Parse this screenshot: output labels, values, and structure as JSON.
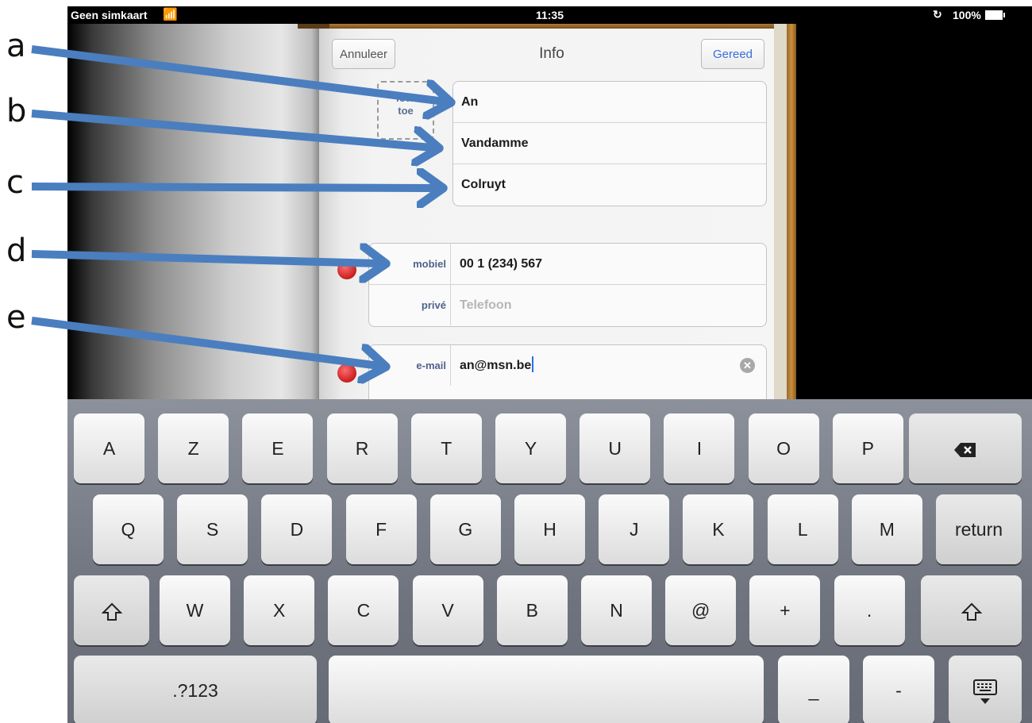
{
  "status_bar": {
    "carrier": "Geen simkaart",
    "time": "11:35",
    "battery": "100%"
  },
  "nav": {
    "cancel": "Annuleer",
    "title": "Info",
    "done": "Gereed"
  },
  "photo": {
    "line1": "foto",
    "line2": "toe"
  },
  "name_fields": {
    "first_name": "An",
    "last_name": "Vandamme",
    "company": "Colruyt"
  },
  "phone_fields": [
    {
      "label": "mobiel",
      "value": "00 1 (234) 567",
      "placeholder": ""
    },
    {
      "label": "privé",
      "value": "",
      "placeholder": "Telefoon"
    }
  ],
  "email_field": {
    "label": "e-mail",
    "value": "an@msn.be"
  },
  "keyboard": {
    "row1": [
      "A",
      "Z",
      "E",
      "R",
      "T",
      "Y",
      "U",
      "I",
      "O",
      "P"
    ],
    "row2": [
      "Q",
      "S",
      "D",
      "F",
      "G",
      "H",
      "J",
      "K",
      "L",
      "M"
    ],
    "return": "return",
    "row3": [
      "W",
      "X",
      "C",
      "V",
      "B",
      "N",
      "@",
      "+",
      "."
    ],
    "row4": {
      "numbers": ".?123",
      "underscore": "_",
      "dash": "-"
    }
  },
  "annotations": [
    "a",
    "b",
    "c",
    "d",
    "e"
  ],
  "colors": {
    "arrow": "#4a7ebf",
    "link_blue": "#3a6fd8",
    "field_label": "#50628b",
    "delete_red": "#c81f1f"
  }
}
